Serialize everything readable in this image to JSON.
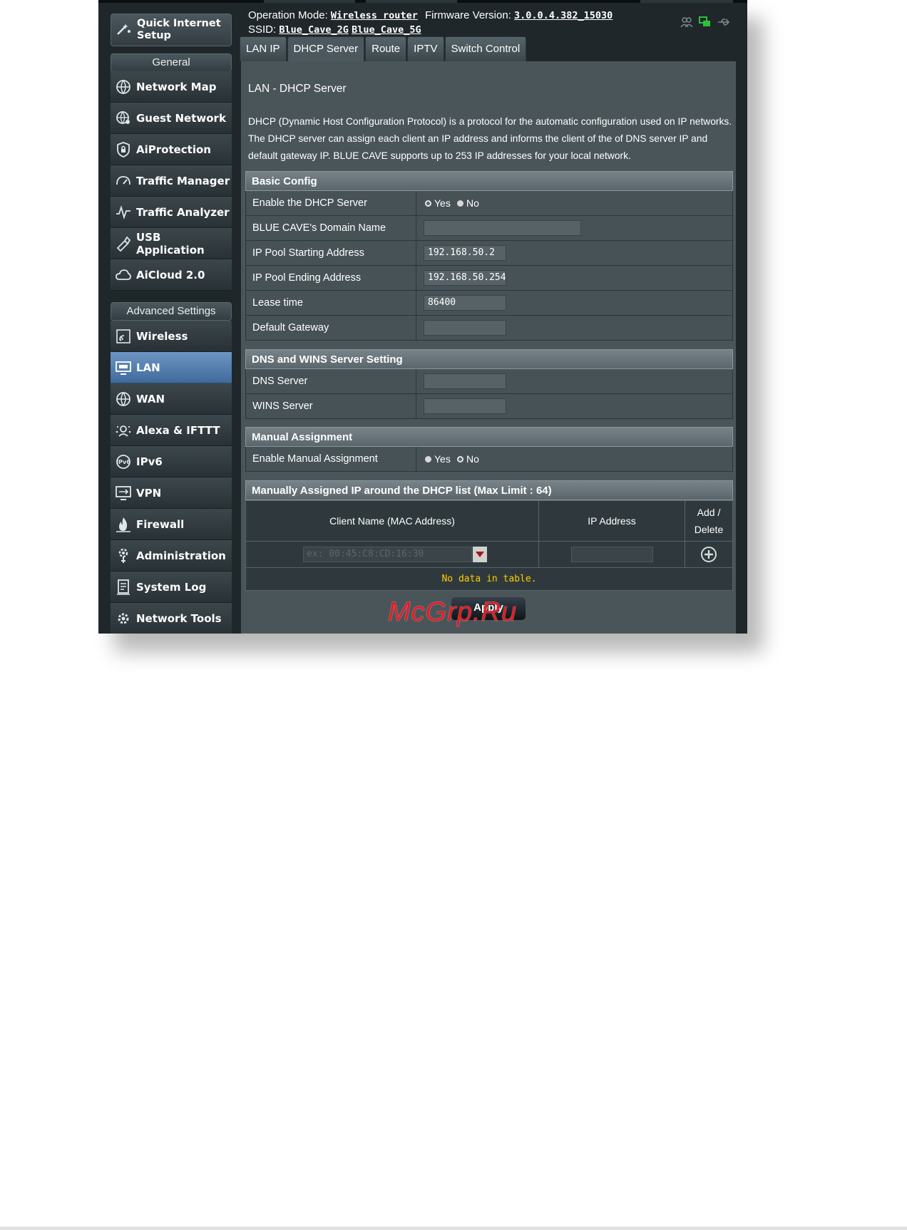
{
  "sidebar": {
    "qis_label": "Quick Internet Setup",
    "general_header": "General",
    "general_items": [
      {
        "label": "Network Map",
        "icon": "globe-icon"
      },
      {
        "label": "Guest Network",
        "icon": "guest-network-icon"
      },
      {
        "label": "AiProtection",
        "icon": "shield-lock-icon"
      },
      {
        "label": "Traffic Manager",
        "icon": "gauge-icon"
      },
      {
        "label": "Traffic Analyzer",
        "icon": "pulse-icon"
      },
      {
        "label": "USB Application",
        "icon": "puzzle-icon"
      },
      {
        "label": "AiCloud 2.0",
        "icon": "cloud-icon"
      }
    ],
    "advanced_header": "Advanced Settings",
    "advanced_items": [
      {
        "label": "Wireless",
        "icon": "wifi-icon"
      },
      {
        "label": "LAN",
        "icon": "lan-monitor-icon",
        "active": true
      },
      {
        "label": "WAN",
        "icon": "globe-icon"
      },
      {
        "label": "Alexa & IFTTT",
        "icon": "alexa-icon"
      },
      {
        "label": "IPv6",
        "icon": "ipv6-icon"
      },
      {
        "label": "VPN",
        "icon": "vpn-monitor-icon"
      },
      {
        "label": "Firewall",
        "icon": "flame-icon"
      },
      {
        "label": "Administration",
        "icon": "admin-gear-icon"
      },
      {
        "label": "System Log",
        "icon": "document-icon"
      },
      {
        "label": "Network Tools",
        "icon": "tools-gear-icon"
      }
    ]
  },
  "header": {
    "op_mode_label": "Operation Mode:",
    "op_mode_value": "Wireless router",
    "fw_label": "Firmware Version:",
    "fw_value": "3.0.0.4.382_15030",
    "ssid_label": "SSID:",
    "ssid_2g": "Blue_Cave_2G",
    "ssid_5g": "Blue_Cave_5G",
    "status_icons": [
      "clients-icon",
      "network-status-icon",
      "usb-icon"
    ]
  },
  "tabs": [
    "LAN IP",
    "DHCP Server",
    "Route",
    "IPTV",
    "Switch Control"
  ],
  "active_tab": "DHCP Server",
  "page": {
    "title": "LAN - DHCP Server",
    "description": "DHCP (Dynamic Host Configuration Protocol) is a protocol for the automatic configuration used on IP networks. The DHCP server can assign each client an IP address and informs the client of the of DNS server IP and default gateway IP. BLUE CAVE supports up to 253 IP addresses for your local network."
  },
  "basic_config": {
    "header": "Basic Config",
    "enable_label": "Enable the DHCP Server",
    "yes": "Yes",
    "no": "No",
    "enable_value": "Yes",
    "domain_label": "BLUE CAVE's Domain Name",
    "domain_value": "",
    "start_label": "IP Pool Starting Address",
    "start_value": "192.168.50.2",
    "end_label": "IP Pool Ending Address",
    "end_value": "192.168.50.254",
    "lease_label": "Lease time",
    "lease_value": "86400",
    "gateway_label": "Default Gateway",
    "gateway_value": ""
  },
  "dns_wins": {
    "header": "DNS and WINS Server Setting",
    "dns_label": "DNS Server",
    "dns_value": "",
    "wins_label": "WINS Server",
    "wins_value": ""
  },
  "manual": {
    "header": "Manual Assignment",
    "enable_label": "Enable Manual Assignment",
    "yes": "Yes",
    "no": "No",
    "enable_value": "No"
  },
  "manual_list": {
    "header": "Manually Assigned IP around the DHCP list (Max Limit : 64)",
    "col_client": "Client Name (MAC Address)",
    "col_ip": "IP Address",
    "col_action_1": "Add /",
    "col_action_2": "Delete",
    "mac_placeholder": "ex: 00:45:C8:CD:16:30",
    "ip_value": "",
    "empty_text": "No data in table."
  },
  "apply_label": "Apply",
  "watermark": "McGrp.Ru",
  "colors": {
    "panel_bg": "#4a555a",
    "sidebar_active": "#4f7eb3",
    "empty_text": "#ffcc00",
    "watermark": "#e31b23"
  }
}
